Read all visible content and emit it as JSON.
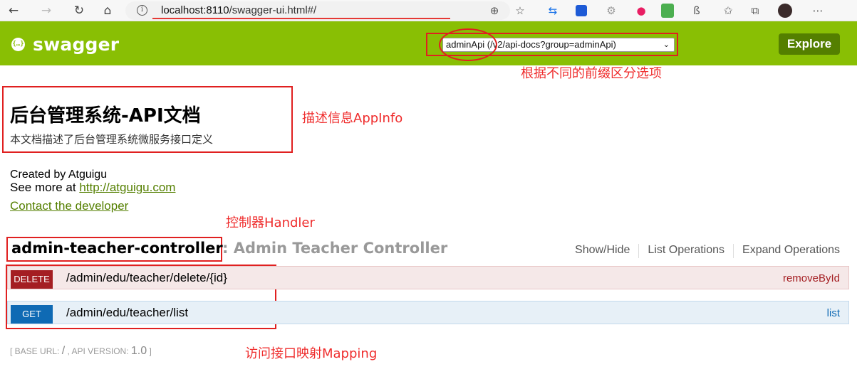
{
  "browser": {
    "url_host": "localhost:8110",
    "url_path": "/swagger-ui.html#/",
    "back_glyph": "←",
    "forward_glyph": "→",
    "refresh_glyph": "↻",
    "home_glyph": "⌂",
    "info_glyph": "i",
    "zoom_glyph": "⊕",
    "star_glyph": "☆",
    "more_glyph": "⋯",
    "favorites_glyph": "✩",
    "collections_glyph": "⧉"
  },
  "header": {
    "logo_symbol": "{…}",
    "logo_text": "swagger",
    "select_value": "adminApi (/v2/api-docs?group=adminApi)",
    "select_caret": "⌄",
    "explore_label": "Explore",
    "brand_color": "#89bf04"
  },
  "annotations": {
    "group_note": "根据不同的前缀区分选项",
    "info_note": "描述信息AppInfo",
    "controller_note": "控制器Handler",
    "mapping_note": "访问接口映射Mapping",
    "color": "#ef2c2c"
  },
  "info": {
    "title": "后台管理系统-API文档",
    "description": "本文档描述了后台管理系统微服务接口定义",
    "created_by": "Created by Atguigu",
    "see_more_prefix": "See more at ",
    "see_more_link": "http://atguigu.com",
    "contact": "Contact the developer"
  },
  "controller": {
    "name": "admin-teacher-controller",
    "description": ": Admin Teacher Controller",
    "actions": [
      "Show/Hide",
      "List Operations",
      "Expand Operations"
    ]
  },
  "operations": [
    {
      "method": "DELETE",
      "path": "/admin/edu/teacher/delete/{id}",
      "summary": "removeById",
      "color": "#a41e22"
    },
    {
      "method": "GET",
      "path": "/admin/edu/teacher/list",
      "summary": "list",
      "color": "#0f6ab4"
    }
  ],
  "footer": {
    "open_bracket": "[ ",
    "base_url_label": "BASE URL",
    "base_url_value": "/",
    "api_version_label": "API VERSION",
    "api_version_value": "1.0",
    "close_bracket": " ]"
  }
}
